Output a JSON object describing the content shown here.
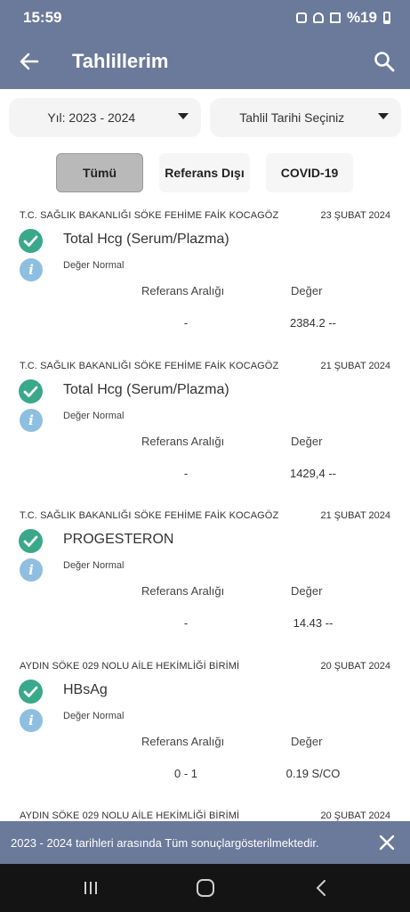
{
  "statusbar": {
    "time": "15:59",
    "battery": "%19"
  },
  "appbar": {
    "title": "Tahlillerim"
  },
  "filters": {
    "year": "Yıl: 2023 - 2024",
    "date": "Tahlil Tarihi Seçiniz"
  },
  "tabs": [
    {
      "label": "Tümü",
      "active": true
    },
    {
      "label": "Referans Dışı",
      "active": false
    },
    {
      "label": "COVID-19",
      "active": false
    }
  ],
  "columns": {
    "reference": "Referans Aralığı",
    "value": "Değer"
  },
  "results": [
    {
      "institution": "T.C. SAĞLIK BAKANLIĞI SÖKE FEHİME FAİK KOCAGÖZ",
      "date": "23 ŞUBAT 2024",
      "test": "Total Hcg (Serum/Plazma)",
      "status": "Değer Normal",
      "reference": "-",
      "value": "2384.2 --"
    },
    {
      "institution": "T.C. SAĞLIK BAKANLIĞI SÖKE FEHİME FAİK KOCAGÖZ",
      "date": "21 ŞUBAT 2024",
      "test": "Total Hcg (Serum/Plazma)",
      "status": "Değer Normal",
      "reference": "-",
      "value": "1429,4 --"
    },
    {
      "institution": "T.C. SAĞLIK BAKANLIĞI SÖKE FEHİME FAİK KOCAGÖZ",
      "date": "21 ŞUBAT 2024",
      "test": "PROGESTERON",
      "status": "Değer Normal",
      "reference": "-",
      "value": "14.43 --"
    },
    {
      "institution": "AYDIN SÖKE 029 NOLU AİLE HEKİMLİĞİ BİRİMİ",
      "date": "20 ŞUBAT 2024",
      "test": "HBsAg",
      "status": "Değer Normal",
      "reference": "0 - 1",
      "value": "0.19 S/CO"
    },
    {
      "institution": "AYDIN SÖKE 029 NOLU AİLE HEKİMLİĞİ BİRİMİ",
      "date": "20 ŞUBAT 2024",
      "test": "",
      "status": "",
      "reference": "",
      "value": ""
    }
  ],
  "snackbar": {
    "message": "2023 - 2024 tarihleri arasında Tüm sonuçlargösterilmektedir."
  },
  "icons": {
    "back": "arrow-left-icon",
    "search": "search-icon",
    "check": "check-circle-icon",
    "info": "info-icon",
    "close": "close-icon"
  },
  "colors": {
    "primary": "#6b7a9a",
    "success": "#3aa88a",
    "info": "#8fbfe0"
  }
}
